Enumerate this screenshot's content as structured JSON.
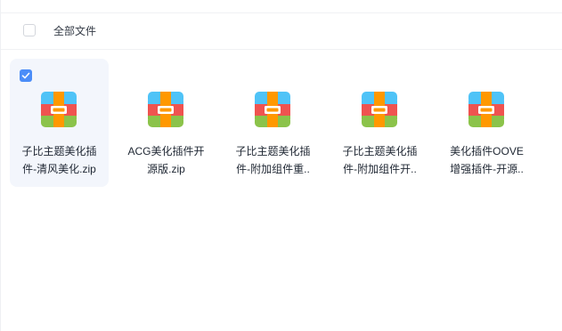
{
  "header": {
    "title": "全部文件"
  },
  "files": [
    {
      "name_line1": "子比主题美化插",
      "name_line2": "件-清风美化.zip",
      "selected": true,
      "icon": "zip-archive-icon"
    },
    {
      "name_line1": "ACG美化插件开",
      "name_line2": "源版.zip",
      "selected": false,
      "icon": "zip-archive-icon"
    },
    {
      "name_line1": "子比主题美化插",
      "name_line2": "件-附加组件重..",
      "selected": false,
      "icon": "zip-archive-icon"
    },
    {
      "name_line1": "子比主题美化插",
      "name_line2": "件-附加组件开..",
      "selected": false,
      "icon": "zip-archive-icon"
    },
    {
      "name_line1": "美化插件OOVE",
      "name_line2": "增强插件-开源..",
      "selected": false,
      "icon": "zip-archive-icon"
    }
  ],
  "colors": {
    "accent": "#4b8df8",
    "icon_top": "#4fc3f7",
    "icon_middle": "#ef5350",
    "icon_bottom": "#8bc34a",
    "icon_strap": "#ff9800"
  }
}
